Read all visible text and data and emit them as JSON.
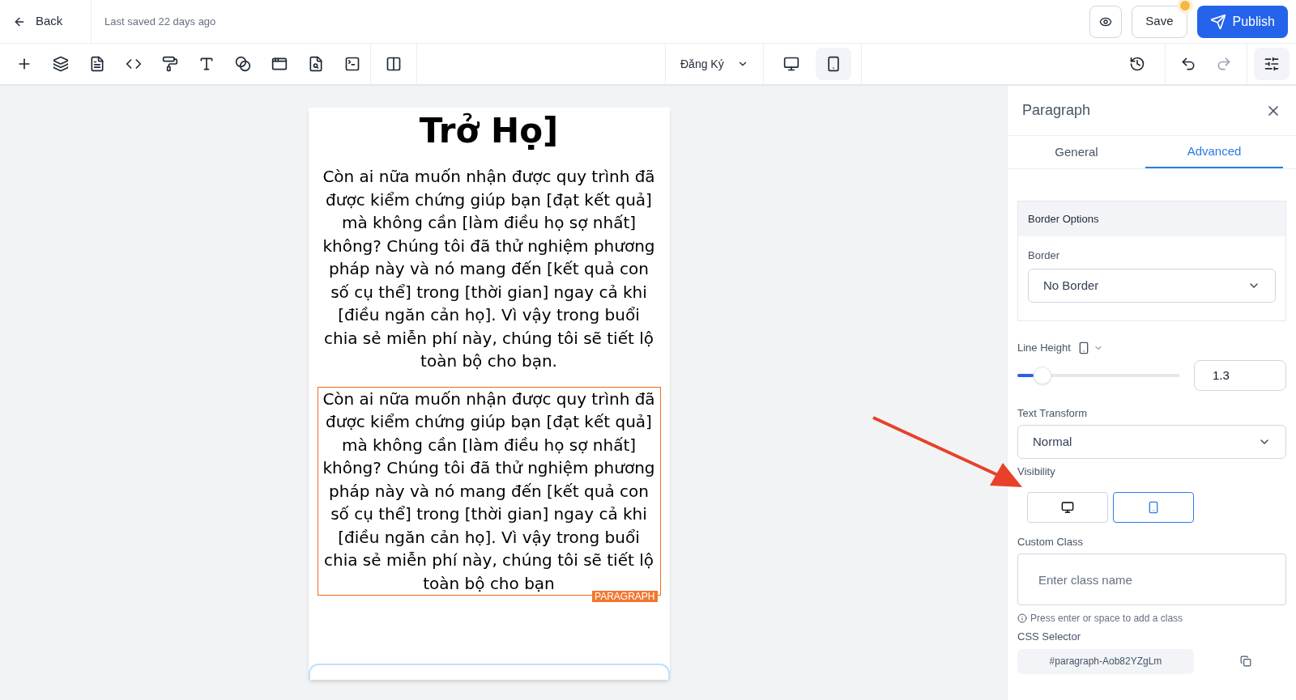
{
  "header": {
    "back_label": "Back",
    "last_saved": "Last saved 22 days ago",
    "save_label": "Save",
    "unsaved": true,
    "publish_label": "Publish"
  },
  "toolbar": {
    "page_select": "Đăng Ký",
    "devices": [
      {
        "kind": "desktop",
        "selected": false
      },
      {
        "kind": "mobile",
        "selected": true
      }
    ]
  },
  "canvas": {
    "heading": "Trở Họ]",
    "paragraphs": [
      {
        "text": "Còn ai nữa muốn nhận được quy trình đã được kiểm chứng giúp bạn [đạt kết quả] mà không cần [làm điều họ sợ nhất] không? Chúng tôi đã thử nghiệm phương pháp này và nó mang đến [kết quả con số cụ thể] trong [thời gian] ngay cả khi [điều ngăn cản họ]. Vì vậy trong buổi chia sẻ miễn phí này, chúng tôi sẽ tiết lộ toàn bộ cho bạn.",
        "selected": false
      },
      {
        "text": "Còn ai nữa muốn nhận được quy trình đã được kiểm chứng giúp bạn [đạt kết quả] mà không cần [làm điều họ sợ nhất] không? Chúng tôi đã thử nghiệm phương pháp này và nó mang đến [kết quả con số cụ thể] trong [thời gian] ngay cả khi [điều ngăn cản họ]. Vì vậy trong buổi chia sẻ miễn phí này, chúng tôi sẽ tiết lộ toàn bộ cho bạn",
        "selected": true,
        "badge": "PARAGRAPH"
      }
    ]
  },
  "panel": {
    "title": "Paragraph",
    "tabs": [
      {
        "label": "General",
        "selected": false
      },
      {
        "label": "Advanced",
        "selected": true
      }
    ],
    "border_options": {
      "title": "Border Options",
      "label": "Border",
      "value": "No Border"
    },
    "line_height": {
      "label": "Line Height",
      "level": 0.1,
      "value": "1.3"
    },
    "text_transform": {
      "label": "Text Transform",
      "value": "Normal"
    },
    "visibility": {
      "label": "Visibility",
      "options": [
        {
          "kind": "desktop",
          "selected": false
        },
        {
          "kind": "mobile",
          "selected": true
        }
      ]
    },
    "custom_class": {
      "label": "Custom Class",
      "placeholder": "Enter class name",
      "hint": "Press enter or space to add a class"
    },
    "css_selector": {
      "label": "CSS Selector",
      "value": "#paragraph-Aob82YZgLm"
    }
  }
}
